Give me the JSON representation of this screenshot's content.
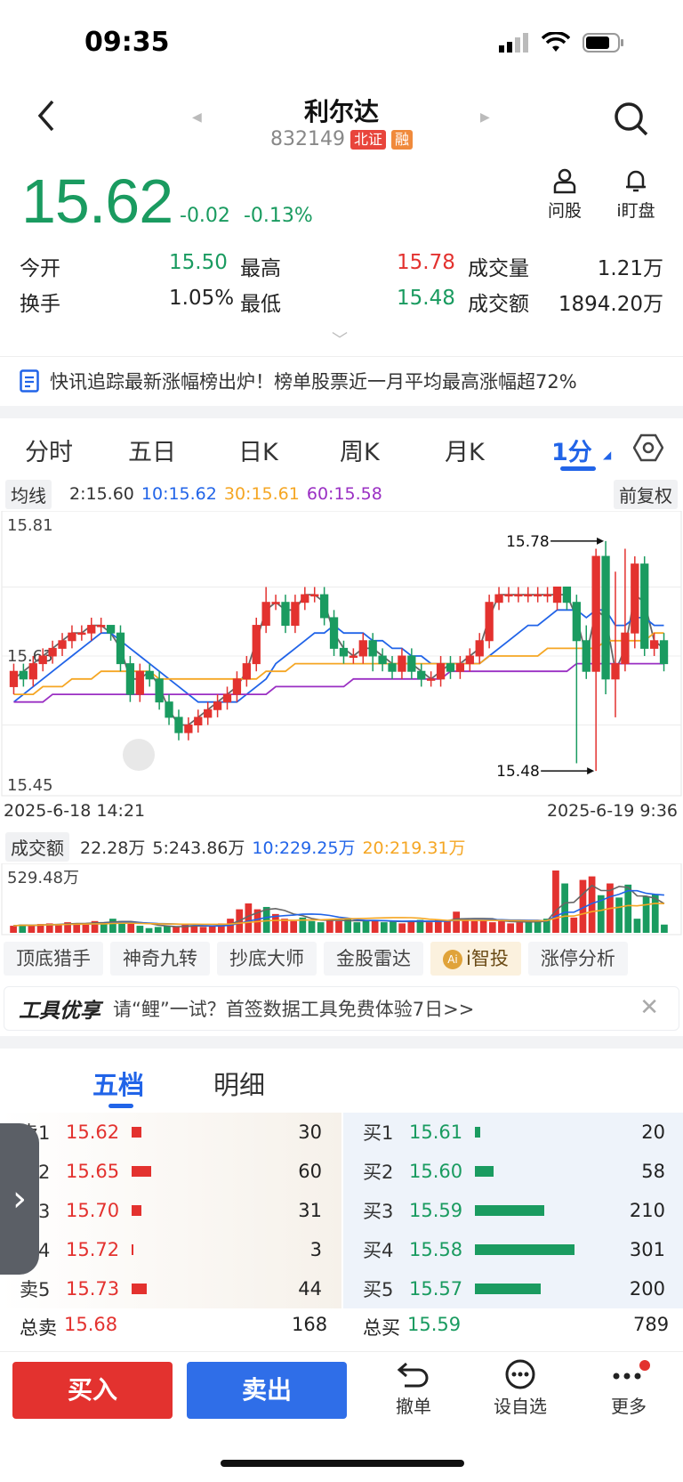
{
  "status": {
    "time": "09:35"
  },
  "header": {
    "name": "利尔达",
    "code": "832149",
    "badge_exchange": "北证",
    "badge_margin": "融"
  },
  "quote": {
    "price": "15.62",
    "change": "-0.02",
    "change_pct": "-0.13%",
    "open_label": "今开",
    "open": "15.50",
    "high_label": "最高",
    "high": "15.78",
    "volume_label": "成交量",
    "volume": "1.21万",
    "turnover_label": "换手",
    "turnover": "1.05%",
    "low_label": "最低",
    "low": "15.48",
    "amount_label": "成交额",
    "amount": "1894.20万"
  },
  "tools": {
    "ask_label": "问股",
    "watch_label": "i盯盘"
  },
  "news": {
    "text": "快讯追踪最新涨幅榜出炉！榜单股票近一月平均最高涨幅超72%"
  },
  "period_tabs": [
    "分时",
    "五日",
    "日K",
    "周K",
    "月K",
    "1分"
  ],
  "ma": {
    "select": "均线",
    "ma2": "2:15.60",
    "ma10": "10:15.62",
    "ma30": "30:15.61",
    "ma60": "60:15.58",
    "adjust": "前复权"
  },
  "chart_data": {
    "type": "candlestick",
    "ylim": [
      15.45,
      15.81
    ],
    "y_ticks": [
      "15.81",
      "15.63",
      "15.45"
    ],
    "x_start": "2025-6-18 14:21",
    "x_end": "2025-6-19 9:36",
    "annotations": {
      "high": "15.78",
      "low": "15.48"
    },
    "candles": [
      [
        15.59,
        15.61,
        15.62,
        15.58
      ],
      [
        15.61,
        15.6,
        15.62,
        15.59
      ],
      [
        15.6,
        15.62,
        15.63,
        15.59
      ],
      [
        15.62,
        15.63,
        15.64,
        15.61
      ],
      [
        15.63,
        15.64,
        15.65,
        15.62
      ],
      [
        15.64,
        15.65,
        15.66,
        15.63
      ],
      [
        15.65,
        15.66,
        15.67,
        15.64
      ],
      [
        15.66,
        15.66,
        15.67,
        15.65
      ],
      [
        15.66,
        15.67,
        15.68,
        15.65
      ],
      [
        15.67,
        15.67,
        15.68,
        15.66
      ],
      [
        15.67,
        15.66,
        15.67,
        15.65
      ],
      [
        15.66,
        15.62,
        15.67,
        15.61
      ],
      [
        15.62,
        15.58,
        15.63,
        15.57
      ],
      [
        15.58,
        15.61,
        15.62,
        15.57
      ],
      [
        15.61,
        15.6,
        15.62,
        15.59
      ],
      [
        15.6,
        15.57,
        15.61,
        15.56
      ],
      [
        15.57,
        15.55,
        15.58,
        15.54
      ],
      [
        15.55,
        15.53,
        15.56,
        15.52
      ],
      [
        15.53,
        15.54,
        15.55,
        15.52
      ],
      [
        15.54,
        15.55,
        15.56,
        15.53
      ],
      [
        15.55,
        15.56,
        15.57,
        15.54
      ],
      [
        15.56,
        15.57,
        15.58,
        15.55
      ],
      [
        15.57,
        15.58,
        15.59,
        15.56
      ],
      [
        15.58,
        15.6,
        15.61,
        15.57
      ],
      [
        15.6,
        15.62,
        15.63,
        15.59
      ],
      [
        15.62,
        15.67,
        15.68,
        15.61
      ],
      [
        15.67,
        15.7,
        15.72,
        15.66
      ],
      [
        15.7,
        15.7,
        15.71,
        15.69
      ],
      [
        15.7,
        15.67,
        15.71,
        15.66
      ],
      [
        15.67,
        15.7,
        15.71,
        15.66
      ],
      [
        15.7,
        15.71,
        15.72,
        15.69
      ],
      [
        15.71,
        15.71,
        15.72,
        15.7
      ],
      [
        15.71,
        15.68,
        15.72,
        15.67
      ],
      [
        15.68,
        15.64,
        15.69,
        15.63
      ],
      [
        15.64,
        15.63,
        15.65,
        15.62
      ],
      [
        15.63,
        15.63,
        15.64,
        15.62
      ],
      [
        15.63,
        15.65,
        15.66,
        15.62
      ],
      [
        15.65,
        15.63,
        15.66,
        15.61
      ],
      [
        15.63,
        15.62,
        15.64,
        15.61
      ],
      [
        15.62,
        15.61,
        15.63,
        15.6
      ],
      [
        15.61,
        15.63,
        15.64,
        15.6
      ],
      [
        15.63,
        15.61,
        15.64,
        15.6
      ],
      [
        15.61,
        15.6,
        15.62,
        15.59
      ],
      [
        15.6,
        15.6,
        15.61,
        15.59
      ],
      [
        15.6,
        15.62,
        15.63,
        15.59
      ],
      [
        15.62,
        15.61,
        15.63,
        15.6
      ],
      [
        15.61,
        15.62,
        15.63,
        15.6
      ],
      [
        15.62,
        15.63,
        15.64,
        15.61
      ],
      [
        15.63,
        15.65,
        15.66,
        15.62
      ],
      [
        15.65,
        15.7,
        15.71,
        15.64
      ],
      [
        15.7,
        15.71,
        15.72,
        15.69
      ],
      [
        15.71,
        15.71,
        15.72,
        15.7
      ],
      [
        15.71,
        15.71,
        15.72,
        15.7
      ],
      [
        15.71,
        15.71,
        15.72,
        15.7
      ],
      [
        15.71,
        15.71,
        15.72,
        15.7
      ],
      [
        15.71,
        15.71,
        15.72,
        15.7
      ],
      [
        15.7,
        15.72,
        15.72,
        15.69
      ],
      [
        15.72,
        15.7,
        15.72,
        15.69
      ],
      [
        15.7,
        15.65,
        15.71,
        15.49
      ],
      [
        15.65,
        15.61,
        15.67,
        15.6
      ],
      [
        15.61,
        15.76,
        15.77,
        15.48
      ],
      [
        15.76,
        15.6,
        15.78,
        15.58
      ],
      [
        15.6,
        15.62,
        15.74,
        15.55
      ],
      [
        15.62,
        15.66,
        15.77,
        15.61
      ],
      [
        15.66,
        15.75,
        15.76,
        15.64
      ],
      [
        15.75,
        15.64,
        15.76,
        15.63
      ],
      [
        15.64,
        15.65,
        15.66,
        15.63
      ],
      [
        15.65,
        15.62,
        15.66,
        15.61
      ]
    ],
    "ma_lines": {
      "ma2": [
        15.6,
        15.61,
        15.62,
        15.63,
        15.64,
        15.65,
        15.66,
        15.66,
        15.67,
        15.67,
        15.66,
        15.64,
        15.6,
        15.6,
        15.61,
        15.59,
        15.56,
        15.54,
        15.54,
        15.55,
        15.56,
        15.57,
        15.58,
        15.59,
        15.61,
        15.65,
        15.69,
        15.7,
        15.69,
        15.69,
        15.71,
        15.71,
        15.7,
        15.66,
        15.64,
        15.63,
        15.64,
        15.64,
        15.63,
        15.62,
        15.62,
        15.62,
        15.61,
        15.6,
        15.61,
        15.62,
        15.62,
        15.63,
        15.64,
        15.68,
        15.71,
        15.71,
        15.71,
        15.71,
        15.71,
        15.71,
        15.71,
        15.71,
        15.68,
        15.63,
        15.69,
        15.68,
        15.61,
        15.64,
        15.71,
        15.7,
        15.65,
        15.64
      ],
      "ma10": [
        15.57,
        15.58,
        15.59,
        15.6,
        15.61,
        15.62,
        15.63,
        15.64,
        15.65,
        15.66,
        15.66,
        15.65,
        15.64,
        15.63,
        15.62,
        15.61,
        15.6,
        15.59,
        15.58,
        15.57,
        15.57,
        15.57,
        15.57,
        15.57,
        15.58,
        15.59,
        15.6,
        15.62,
        15.63,
        15.64,
        15.65,
        15.66,
        15.66,
        15.67,
        15.66,
        15.66,
        15.66,
        15.65,
        15.65,
        15.64,
        15.64,
        15.63,
        15.63,
        15.62,
        15.62,
        15.62,
        15.62,
        15.62,
        15.62,
        15.63,
        15.64,
        15.65,
        15.66,
        15.67,
        15.67,
        15.68,
        15.69,
        15.69,
        15.69,
        15.68,
        15.69,
        15.69,
        15.67,
        15.67,
        15.68,
        15.68,
        15.67,
        15.67
      ],
      "ma30": [
        15.58,
        15.58,
        15.58,
        15.59,
        15.59,
        15.59,
        15.6,
        15.6,
        15.6,
        15.61,
        15.61,
        15.61,
        15.61,
        15.61,
        15.61,
        15.6,
        15.6,
        15.6,
        15.6,
        15.6,
        15.6,
        15.6,
        15.6,
        15.6,
        15.6,
        15.6,
        15.61,
        15.61,
        15.61,
        15.62,
        15.62,
        15.62,
        15.62,
        15.62,
        15.62,
        15.62,
        15.62,
        15.62,
        15.62,
        15.62,
        15.62,
        15.62,
        15.62,
        15.62,
        15.62,
        15.62,
        15.62,
        15.62,
        15.62,
        15.63,
        15.63,
        15.63,
        15.63,
        15.63,
        15.63,
        15.64,
        15.64,
        15.64,
        15.64,
        15.64,
        15.64,
        15.65,
        15.65,
        15.65,
        15.65,
        15.65,
        15.66,
        15.66
      ],
      "ma60": [
        15.57,
        15.57,
        15.57,
        15.57,
        15.58,
        15.58,
        15.58,
        15.58,
        15.58,
        15.58,
        15.58,
        15.58,
        15.58,
        15.58,
        15.58,
        15.58,
        15.58,
        15.58,
        15.58,
        15.58,
        15.58,
        15.58,
        15.58,
        15.58,
        15.58,
        15.58,
        15.58,
        15.59,
        15.59,
        15.59,
        15.59,
        15.59,
        15.59,
        15.59,
        15.59,
        15.6,
        15.6,
        15.6,
        15.6,
        15.6,
        15.6,
        15.6,
        15.6,
        15.6,
        15.6,
        15.61,
        15.61,
        15.61,
        15.61,
        15.61,
        15.61,
        15.61,
        15.61,
        15.61,
        15.61,
        15.61,
        15.61,
        15.61,
        15.62,
        15.62,
        15.62,
        15.62,
        15.62,
        15.62,
        15.62,
        15.62,
        15.62,
        15.62
      ]
    },
    "volume": {
      "max_label": "529.48万",
      "values": [
        60,
        70,
        60,
        75,
        80,
        70,
        90,
        80,
        80,
        100,
        80,
        120,
        100,
        80,
        60,
        40,
        50,
        60,
        50,
        70,
        60,
        50,
        60,
        80,
        120,
        200,
        250,
        200,
        220,
        160,
        120,
        100,
        130,
        100,
        90,
        110,
        100,
        120,
        90,
        100,
        110,
        90,
        100,
        80,
        100,
        110,
        90,
        110,
        100,
        180,
        120,
        100,
        110,
        90,
        100,
        80,
        90,
        100,
        100,
        120,
        530,
        420,
        130,
        450,
        480,
        320,
        420,
        300,
        410,
        120,
        310,
        330,
        70
      ]
    }
  },
  "vol_header": {
    "select": "成交额",
    "v": "22.28万",
    "v5": "5:243.86万",
    "v10": "10:229.25万",
    "v20": "20:219.31万"
  },
  "tool_chips": [
    "顶底猎手",
    "神奇九转",
    "抄底大师",
    "金股雷达",
    "i智投",
    "涨停分析"
  ],
  "promo": {
    "logo": "工具优享",
    "text": "请“鲤”一试？首签数据工具免费体验7日>>"
  },
  "book_tabs": [
    "五档",
    "明细"
  ],
  "asks": [
    {
      "label": "卖1",
      "price": "15.62",
      "vol": "30",
      "pct": 0.1
    },
    {
      "label": "卖2",
      "price": "15.65",
      "vol": "60",
      "pct": 0.2
    },
    {
      "label": "卖3",
      "price": "15.70",
      "vol": "31",
      "pct": 0.1
    },
    {
      "label": "卖4",
      "price": "15.72",
      "vol": "3",
      "pct": 0.01
    },
    {
      "label": "卖5",
      "price": "15.73",
      "vol": "44",
      "pct": 0.15
    }
  ],
  "bids": [
    {
      "label": "买1",
      "price": "15.61",
      "vol": "20",
      "pct": 0.05
    },
    {
      "label": "买2",
      "price": "15.60",
      "vol": "58",
      "pct": 0.19
    },
    {
      "label": "买3",
      "price": "15.59",
      "vol": "210",
      "pct": 0.7
    },
    {
      "label": "买4",
      "price": "15.58",
      "vol": "301",
      "pct": 1.0
    },
    {
      "label": "买5",
      "price": "15.57",
      "vol": "200",
      "pct": 0.66
    }
  ],
  "totals": {
    "sell_label": "总卖",
    "sell_price": "15.68",
    "sell_vol": "168",
    "buy_label": "总买",
    "buy_price": "15.59",
    "buy_vol": "789"
  },
  "bottom": {
    "buy": "买入",
    "sell": "卖出",
    "cancel": "撤单",
    "watchlist": "设自选",
    "more": "更多"
  },
  "colors": {
    "up": "#e3322f",
    "down": "#1a9b60",
    "blue": "#2164e8",
    "orange": "#f5a623",
    "purple": "#9a2fc3"
  }
}
